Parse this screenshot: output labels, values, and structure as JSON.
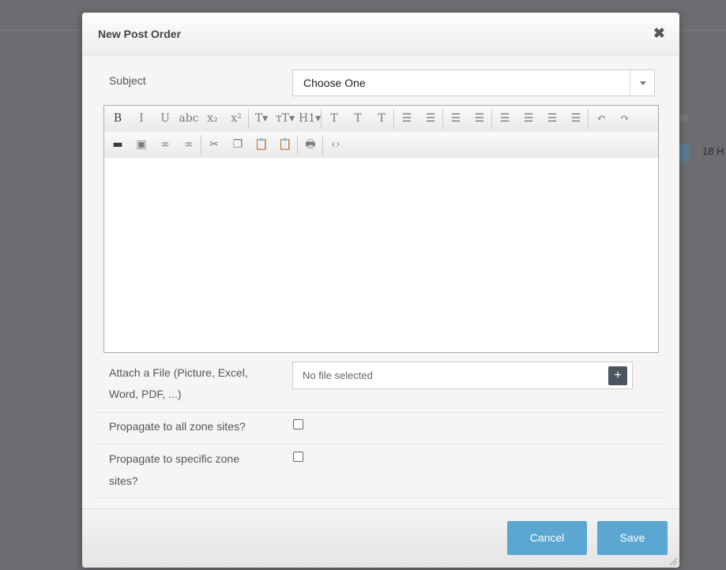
{
  "background": {
    "header_fragment": "d)",
    "cell_fragment": "18 H"
  },
  "modal": {
    "title": "New Post Order",
    "close_icon": "close-icon"
  },
  "form": {
    "subject": {
      "label": "Subject",
      "selected": "Choose One"
    },
    "editor": {
      "toolbar_row1": [
        {
          "name": "bold-icon",
          "glyph": "B"
        },
        {
          "name": "italic-icon",
          "glyph": "I"
        },
        {
          "name": "underline-icon",
          "glyph": "U"
        },
        {
          "name": "strikethrough-icon",
          "glyph": "abc"
        },
        {
          "name": "subscript-icon",
          "glyph": "x₂"
        },
        {
          "name": "superscript-icon",
          "glyph": "x²"
        },
        {
          "name": "font-icon",
          "glyph": "T▾"
        },
        {
          "name": "font-size-icon",
          "glyph": "тT▾"
        },
        {
          "name": "heading-icon",
          "glyph": "H1▾"
        },
        {
          "name": "text-color-icon",
          "glyph": "T"
        },
        {
          "name": "highlight-icon",
          "glyph": "T"
        },
        {
          "name": "clear-format-icon",
          "glyph": "T"
        },
        {
          "name": "bullet-list-icon",
          "glyph": "☰"
        },
        {
          "name": "numbered-list-icon",
          "glyph": "☰"
        },
        {
          "name": "outdent-icon",
          "glyph": "☰"
        },
        {
          "name": "indent-icon",
          "glyph": "☰"
        },
        {
          "name": "align-left-icon",
          "glyph": "☰"
        },
        {
          "name": "align-center-icon",
          "glyph": "☰"
        },
        {
          "name": "align-right-icon",
          "glyph": "☰"
        },
        {
          "name": "justify-icon",
          "glyph": "☰"
        },
        {
          "name": "undo-icon",
          "glyph": "↶"
        },
        {
          "name": "redo-icon",
          "glyph": "↷"
        }
      ],
      "toolbar_row2": [
        {
          "name": "horizontal-rule-icon",
          "glyph": "▬"
        },
        {
          "name": "image-icon",
          "glyph": "▣"
        },
        {
          "name": "link-icon",
          "glyph": "∞"
        },
        {
          "name": "unlink-icon",
          "glyph": "∞"
        },
        {
          "name": "cut-icon",
          "glyph": "✂"
        },
        {
          "name": "copy-icon",
          "glyph": "❐"
        },
        {
          "name": "paste-icon",
          "glyph": "📋"
        },
        {
          "name": "paste-text-icon",
          "glyph": "📋"
        },
        {
          "name": "print-icon",
          "glyph": "🖶"
        },
        {
          "name": "source-code-icon",
          "glyph": "‹›"
        }
      ]
    },
    "attachment": {
      "label_line1": "Attach a File (Picture, Excel,",
      "label_line2": "Word, PDF, ...)",
      "value": "No file selected",
      "button": "+"
    },
    "propagate_all": {
      "label": "Propagate to all zone sites?",
      "checked": false
    },
    "propagate_specific": {
      "label_line1": "Propagate to specific zone",
      "label_line2": "sites?",
      "checked": false
    }
  },
  "footer": {
    "cancel_label": "Cancel",
    "save_label": "Save"
  },
  "colors": {
    "overlay": "#6b6d70",
    "primary_button": "#5ba7d1",
    "add_button": "#4d5561"
  }
}
